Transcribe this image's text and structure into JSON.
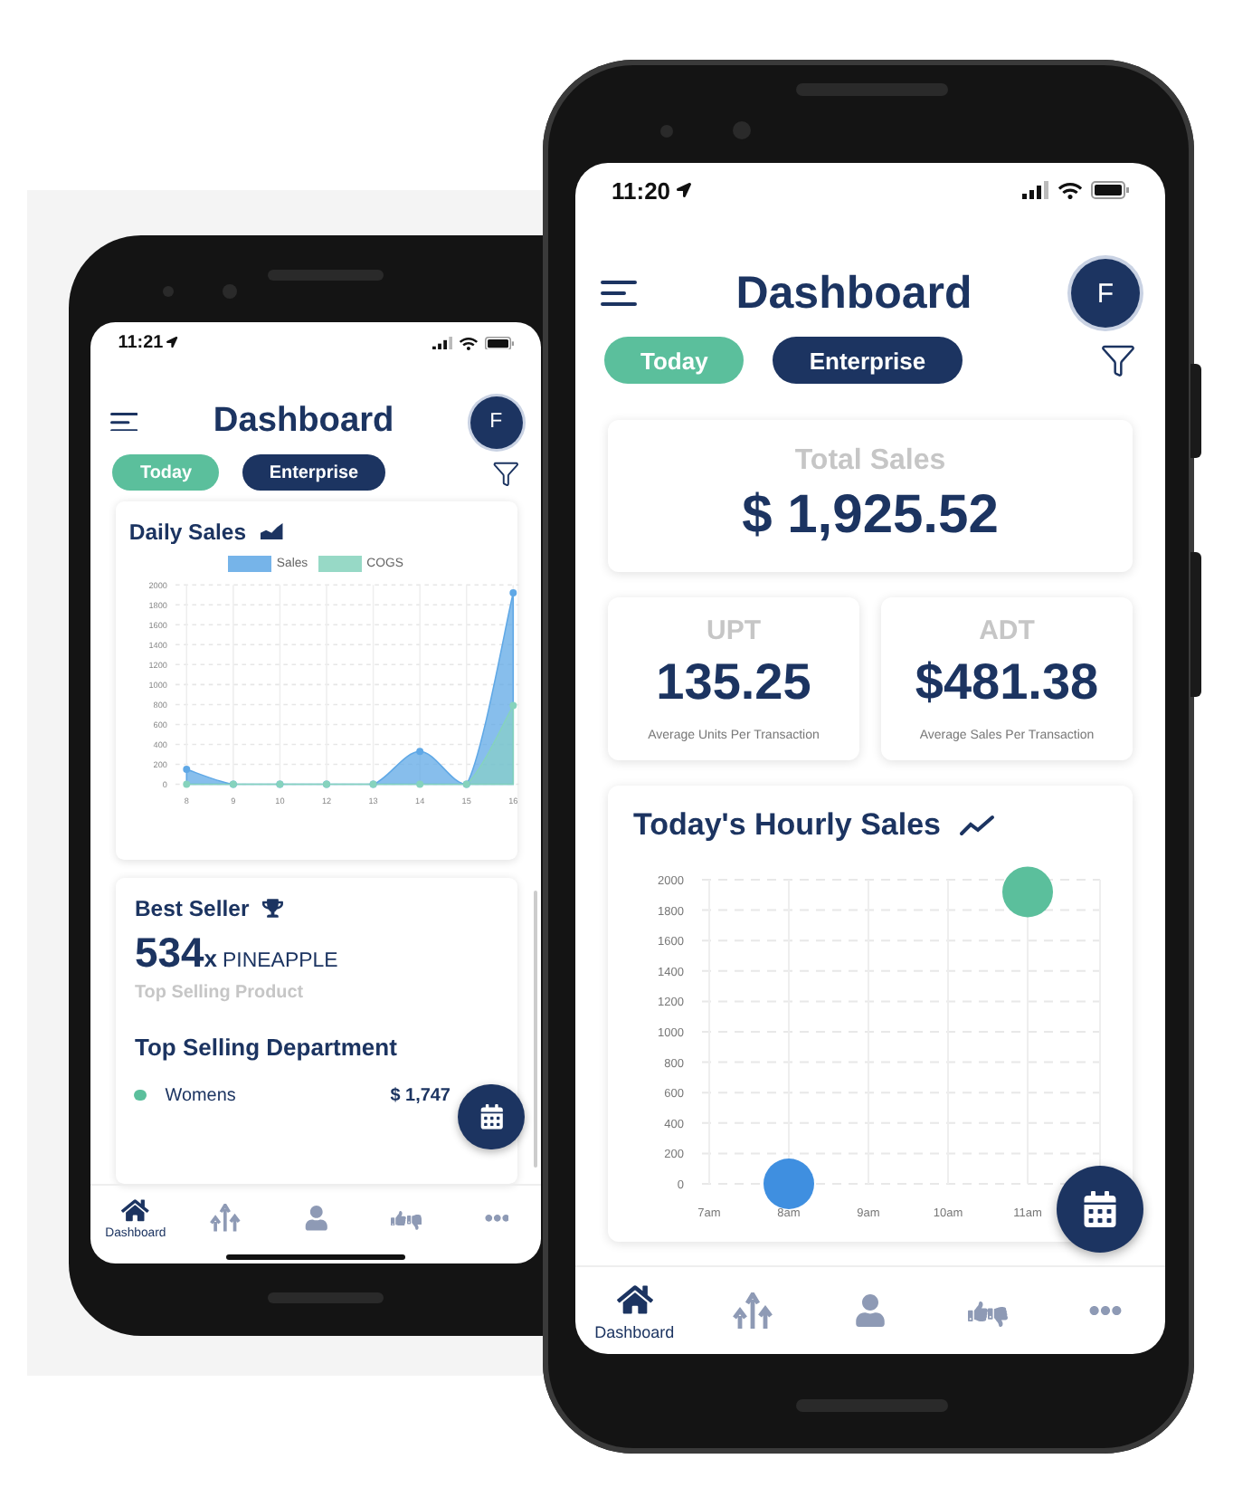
{
  "left_phone": {
    "status_bar": {
      "time": "11:21"
    },
    "header": {
      "title": "Dashboard",
      "avatar": "F"
    },
    "chips": [
      {
        "label": "Today",
        "kind": "date"
      },
      {
        "label": "Enterprise",
        "kind": "location"
      }
    ],
    "daily_sales": {
      "title": "Daily Sales",
      "chart_data": {
        "type": "area",
        "categories": [
          "8",
          "9",
          "10",
          "12",
          "13",
          "14",
          "15",
          "16"
        ],
        "series": [
          {
            "name": "Sales",
            "color": "#5fa8e6",
            "values": [
              150,
              0,
              0,
              0,
              0,
              330,
              0,
              1920
            ]
          },
          {
            "name": "COGS",
            "color": "#86d3bd",
            "values": [
              0,
              0,
              0,
              0,
              0,
              0,
              0,
              790
            ]
          }
        ],
        "ylim": [
          0,
          2000
        ],
        "yticks": [
          0,
          200,
          400,
          600,
          800,
          1000,
          1200,
          1400,
          1600,
          1800,
          2000
        ],
        "grid": true,
        "legend": true
      }
    },
    "best_seller": {
      "title": "Best Seller",
      "count": "534",
      "unit": "x",
      "product": "PINEAPPLE",
      "caption": "Top Selling Product"
    },
    "top_department": {
      "title": "Top Selling Department",
      "rows": [
        {
          "name": "Womens",
          "amount": "$ 1,747",
          "color": "#5bbf9c"
        }
      ]
    },
    "nav": [
      {
        "label": "Dashboard",
        "selected": true
      },
      {
        "selected": false
      },
      {
        "selected": false
      },
      {
        "selected": false
      },
      {
        "selected": false
      }
    ]
  },
  "right_phone": {
    "status_bar": {
      "time": "11:20"
    },
    "header": {
      "title": "Dashboard",
      "avatar": "F"
    },
    "chips": [
      {
        "label": "Today",
        "kind": "date"
      },
      {
        "label": "Enterprise",
        "kind": "location"
      }
    ],
    "total_sales": {
      "label": "Total Sales",
      "value": "$ 1,925.52"
    },
    "metrics": [
      {
        "label": "UPT",
        "value": "135.25",
        "caption": "Average Units Per Transaction"
      },
      {
        "label": "ADT",
        "value": "$481.38",
        "caption": "Average Sales Per Transaction"
      }
    ],
    "hourly_sales": {
      "title": "Today's Hourly Sales",
      "chart_data": {
        "type": "scatter",
        "categories": [
          "7am",
          "8am",
          "9am",
          "10am",
          "11am"
        ],
        "series": [
          {
            "color": "#3f8fe0",
            "values": [
              null,
              0,
              null,
              null,
              null
            ]
          },
          {
            "color": "#5bbf9c",
            "values": [
              null,
              null,
              null,
              null,
              1920
            ]
          }
        ],
        "ylim": [
          0,
          2000
        ],
        "yticks": [
          0,
          200,
          400,
          600,
          800,
          1000,
          1200,
          1400,
          1600,
          1800,
          2000
        ],
        "grid": true
      }
    },
    "nav": [
      {
        "label": "Dashboard",
        "selected": true
      },
      {
        "selected": false
      },
      {
        "selected": false
      },
      {
        "selected": false
      },
      {
        "selected": false
      }
    ]
  }
}
